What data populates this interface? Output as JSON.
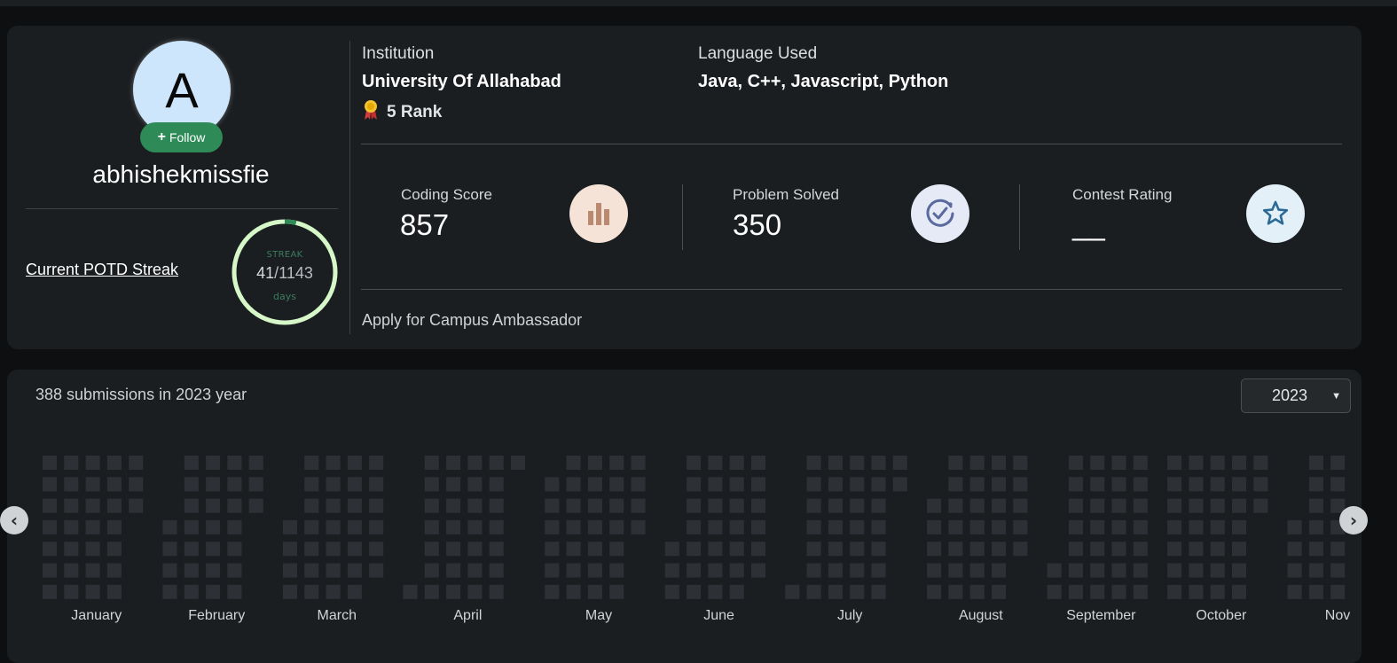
{
  "profile": {
    "avatar_letter": "A",
    "follow_label": "Follow",
    "username": "abhishekmissfie",
    "potd_link": "Current POTD Streak",
    "streak": {
      "label": "STREAK",
      "current": "41",
      "total": "/1143",
      "unit": "days",
      "progress_fraction": 0.036
    }
  },
  "info": {
    "institution_label": "Institution",
    "institution_value": "University Of Allahabad",
    "rank": "5 Rank",
    "language_label": "Language Used",
    "language_value": "Java, C++, Javascript, Python"
  },
  "stats": [
    {
      "label": "Coding Score",
      "value": "857",
      "icon": "bar-chart-icon",
      "icon_bg": "#f6e3d8"
    },
    {
      "label": "Problem Solved",
      "value": "350",
      "icon": "check-clock-icon",
      "icon_bg": "#e6eaf7"
    },
    {
      "label": "Contest Rating",
      "value": "__",
      "icon": "star-icon",
      "icon_bg": "#e3f0f8"
    }
  ],
  "ambassador_link": "Apply for Campus Ambassador",
  "heatmap": {
    "summary": "388 submissions in 2023 year",
    "year_selected": "2023",
    "cell_color": "#2d3136",
    "months": [
      "January",
      "February",
      "March",
      "April",
      "May",
      "June",
      "July",
      "August",
      "September",
      "October",
      "Nov"
    ]
  },
  "colors": {
    "streak_ring": "#d6f8c8",
    "streak_progress": "#2e8b57",
    "follow_green": "#2e8b57",
    "avatar_bg": "#cde6fb"
  }
}
